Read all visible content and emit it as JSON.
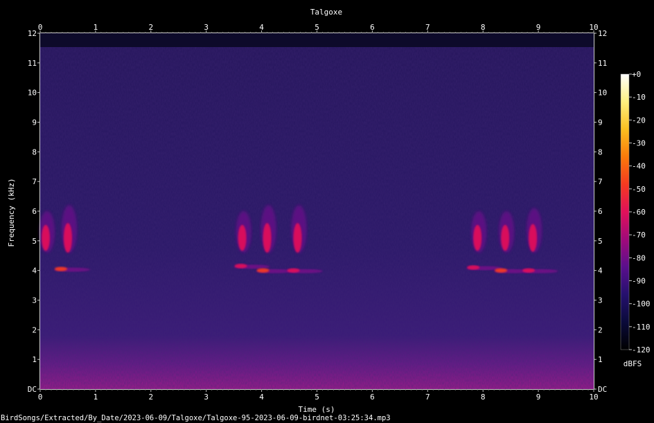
{
  "chart_data": {
    "type": "heatmap",
    "title": "Talgoxe",
    "xlabel": "Time (s)",
    "ylabel": "Frequency (kHz)",
    "xlim": [
      0,
      10
    ],
    "ylim": [
      0,
      12
    ],
    "x_ticks": [
      "0",
      "1",
      "2",
      "3",
      "4",
      "5",
      "6",
      "7",
      "8",
      "9",
      "10"
    ],
    "y_ticks": [
      "DC",
      "1",
      "2",
      "3",
      "4",
      "5",
      "6",
      "7",
      "8",
      "9",
      "10",
      "11",
      "12"
    ],
    "colorbar": {
      "unit": "dBFS",
      "ticks": [
        "+0",
        "-10",
        "-20",
        "-30",
        "-40",
        "-50",
        "-60",
        "-70",
        "-80",
        "-90",
        "-100",
        "-110",
        "-120"
      ],
      "range": [
        -120,
        0
      ],
      "colors": [
        "#000000",
        "#0a0a3a",
        "#25106e",
        "#5a0f8c",
        "#a00a7a",
        "#e0105a",
        "#f53a20",
        "#fa7a0a",
        "#fbc020",
        "#fdf080",
        "#ffffff"
      ]
    },
    "background_color": "#25165c",
    "low_band_color": "#8a1a8e",
    "calls": [
      {
        "t": 0.05,
        "f_low": 4.6,
        "f_high": 6.0,
        "peak": 5.1,
        "level": -70
      },
      {
        "t": 0.45,
        "f_low": 4.6,
        "f_high": 6.2,
        "peak": 5.1,
        "level": -68
      },
      {
        "t": 3.6,
        "f_low": 4.6,
        "f_high": 6.0,
        "peak": 5.1,
        "level": -70
      },
      {
        "t": 4.05,
        "f_low": 4.6,
        "f_high": 6.2,
        "peak": 5.1,
        "level": -66
      },
      {
        "t": 4.6,
        "f_low": 4.6,
        "f_high": 6.2,
        "peak": 5.1,
        "level": -68
      },
      {
        "t": 7.85,
        "f_low": 4.6,
        "f_high": 6.0,
        "peak": 5.1,
        "level": -68
      },
      {
        "t": 8.35,
        "f_low": 4.6,
        "f_high": 6.0,
        "peak": 5.1,
        "level": -68
      },
      {
        "t": 8.85,
        "f_low": 4.6,
        "f_high": 6.1,
        "peak": 5.1,
        "level": -68
      }
    ],
    "notes": [
      {
        "t": 0.3,
        "f": 4.05,
        "level": -60
      },
      {
        "t": 3.55,
        "f": 4.15,
        "level": -62
      },
      {
        "t": 3.95,
        "f": 4.0,
        "level": -60
      },
      {
        "t": 4.5,
        "f": 4.0,
        "level": -62
      },
      {
        "t": 7.75,
        "f": 4.1,
        "level": -62
      },
      {
        "t": 8.25,
        "f": 4.0,
        "level": -60
      },
      {
        "t": 8.75,
        "f": 4.0,
        "level": -62
      }
    ]
  },
  "footer": {
    "filepath": "BirdSongs/Extracted/By_Date/2023-06-09/Talgoxe/Talgoxe-95-2023-06-09-birdnet-03:25:34.mp3"
  }
}
